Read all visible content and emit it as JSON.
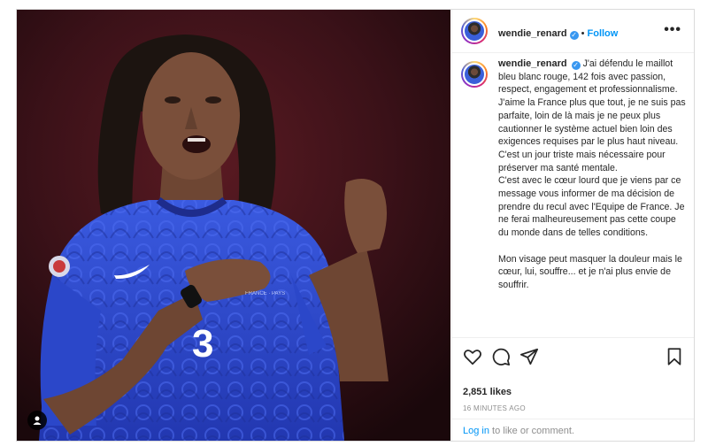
{
  "post": {
    "username": "wendie_renard",
    "follow_label": "Follow",
    "dot": "•",
    "more_label": "•••",
    "verified_mark": "✓",
    "caption": "J'ai défendu le maillot bleu blanc rouge, 142 fois avec passion, respect, engagement et professionnalisme. J'aime la France plus que tout, je ne suis pas parfaite, loin de là mais je ne peux plus cautionner le système actuel bien loin des exigences requises par le plus haut niveau.\nC'est un jour triste mais nécessaire pour préserver ma santé mentale.\nC'est avec le cœur lourd que je viens par ce message vous informer de ma décision de prendre du recul avec l'Equipe de France. Je ne ferai malheureusement pas cette coupe du monde dans de telles conditions.\n\nMon visage peut masquer la douleur mais le cœur, lui, souffre... et je n'ai plus envie de souffrir.",
    "likes": "2,851 likes",
    "time": "16 MINUTES AGO",
    "login_link": "Log in",
    "login_rest": " to like or comment.",
    "jersey_number": "3"
  },
  "icons": [
    "heart-icon",
    "comment-icon",
    "share-icon",
    "bookmark-icon",
    "user-tag-icon",
    "more-options-icon",
    "verified-badge-icon"
  ],
  "colors": {
    "accent": "#0095f6",
    "verified": "#3897f0",
    "jersey": "#2b47c9",
    "background_dark": "#2a0f14",
    "muted_text": "#8e8e8e"
  }
}
